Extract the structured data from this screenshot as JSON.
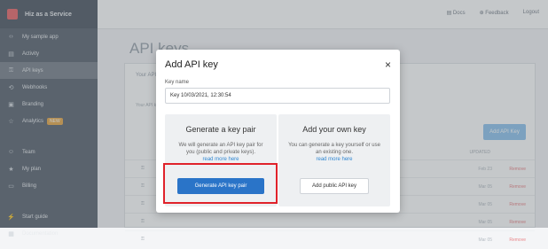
{
  "app": {
    "brand": "Hiz as a Service",
    "colors": {
      "accent": "#2a74c8",
      "highlight": "#e0222a",
      "logo": "#e9676b"
    }
  },
  "sidebar": {
    "items": [
      {
        "label": "My sample app",
        "icon": "app-icon"
      },
      {
        "label": "Activity",
        "icon": "activity-icon"
      },
      {
        "label": "API keys",
        "icon": "key-icon",
        "active": true
      },
      {
        "label": "Webhooks",
        "icon": "webhook-icon"
      },
      {
        "label": "Branding",
        "icon": "branding-icon"
      },
      {
        "label": "Analytics",
        "icon": "analytics-icon",
        "badge": "NEW"
      },
      {
        "label": "Team",
        "icon": "team-icon"
      },
      {
        "label": "My plan",
        "icon": "plan-icon"
      },
      {
        "label": "Billing",
        "icon": "billing-icon"
      },
      {
        "label": "Start guide",
        "icon": "guide-icon"
      },
      {
        "label": "Documentation",
        "icon": "docs-icon"
      }
    ]
  },
  "topbar": {
    "docs": "Docs",
    "feedback": "Feedback",
    "logout": "Logout"
  },
  "page": {
    "title": "API keys",
    "card_header": "Your API",
    "card_desc": "Your API ke",
    "add_button": "Add API Key",
    "updated_header": "UPDATED",
    "rows": [
      {
        "date": "Feb 23",
        "action": "Remove"
      },
      {
        "date": "Mar 05",
        "action": "Remove"
      },
      {
        "date": "Mar 05",
        "action": "Remove"
      },
      {
        "date": "Mar 05",
        "action": "Remove"
      },
      {
        "date": "Mar 05",
        "action": "Remove"
      }
    ]
  },
  "modal": {
    "title": "Add API key",
    "close": "×",
    "key_name_label": "Key name",
    "key_name_value": "Key 10/03/2021, 12:30:54",
    "generate": {
      "heading": "Generate a key pair",
      "text": "We will generate an API key pair for you (public and private keys).",
      "link": "read more here",
      "button": "Generate API key pair"
    },
    "own": {
      "heading": "Add your own key",
      "text": "You can generate a key yourself or use an existing one.",
      "link": "read more here",
      "button": "Add public API key"
    }
  }
}
